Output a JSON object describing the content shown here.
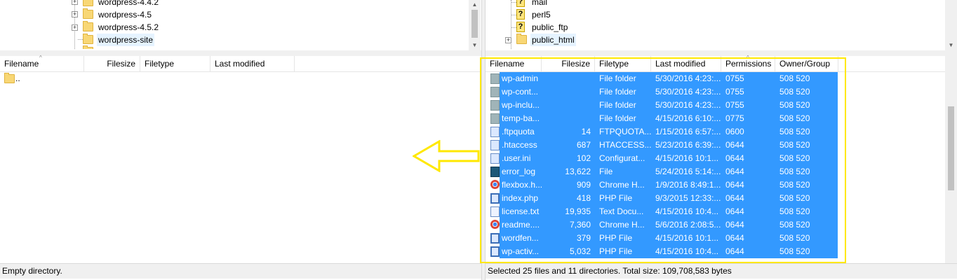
{
  "local_tree": {
    "items": [
      {
        "label": "wordpress-4.4.2",
        "expandable": true,
        "selected": false
      },
      {
        "label": "wordpress-4.5",
        "expandable": true,
        "selected": false
      },
      {
        "label": "wordpress-4.5.2",
        "expandable": true,
        "selected": false
      },
      {
        "label": "wordpress-site",
        "expandable": false,
        "selected": true
      }
    ]
  },
  "remote_tree": {
    "items": [
      {
        "label": "mail",
        "icon": "unknown-folder-icon",
        "selected": false
      },
      {
        "label": "perl5",
        "icon": "unknown-folder-icon",
        "selected": false
      },
      {
        "label": "public_ftp",
        "icon": "unknown-folder-icon",
        "selected": false
      },
      {
        "label": "public_html",
        "icon": "folder-icon",
        "selected": true
      }
    ]
  },
  "local_list": {
    "columns": [
      "Filename",
      "Filesize",
      "Filetype",
      "Last modified"
    ],
    "rows": [
      {
        "name": ".."
      }
    ]
  },
  "remote_list": {
    "columns": [
      "Filename",
      "Filesize",
      "Filetype",
      "Last modified",
      "Permissions",
      "Owner/Group"
    ],
    "rows": [
      {
        "name": "wp-admin",
        "size": "",
        "type": "File folder",
        "modified": "5/30/2016 4:23:...",
        "perm": "0755",
        "owner": "508 520",
        "icon": "folder"
      },
      {
        "name": "wp-cont...",
        "size": "",
        "type": "File folder",
        "modified": "5/30/2016 4:23:...",
        "perm": "0755",
        "owner": "508 520",
        "icon": "folder"
      },
      {
        "name": "wp-inclu...",
        "size": "",
        "type": "File folder",
        "modified": "5/30/2016 4:23:...",
        "perm": "0755",
        "owner": "508 520",
        "icon": "folder"
      },
      {
        "name": "temp-ba...",
        "size": "",
        "type": "File folder",
        "modified": "4/15/2016 6:10:...",
        "perm": "0775",
        "owner": "508 520",
        "icon": "folder"
      },
      {
        "name": ".ftpquota",
        "size": "14",
        "type": "FTPQUOTA...",
        "modified": "1/15/2016 6:57:...",
        "perm": "0600",
        "owner": "508 520",
        "icon": "file"
      },
      {
        "name": ".htaccess",
        "size": "687",
        "type": "HTACCESS...",
        "modified": "5/23/2016 6:39:...",
        "perm": "0644",
        "owner": "508 520",
        "icon": "file"
      },
      {
        "name": ".user.ini",
        "size": "102",
        "type": "Configurat...",
        "modified": "4/15/2016 10:1...",
        "perm": "0644",
        "owner": "508 520",
        "icon": "config"
      },
      {
        "name": "error_log",
        "size": "13,622",
        "type": "File",
        "modified": "5/24/2016 5:14:...",
        "perm": "0644",
        "owner": "508 520",
        "icon": "app"
      },
      {
        "name": "flexbox.h...",
        "size": "909",
        "type": "Chrome H...",
        "modified": "1/9/2016 8:49:1...",
        "perm": "0644",
        "owner": "508 520",
        "icon": "chrome"
      },
      {
        "name": "index.php",
        "size": "418",
        "type": "PHP File",
        "modified": "9/3/2015 12:33:...",
        "perm": "0644",
        "owner": "508 520",
        "icon": "php"
      },
      {
        "name": "license.txt",
        "size": "19,935",
        "type": "Text Docu...",
        "modified": "4/15/2016 10:4...",
        "perm": "0644",
        "owner": "508 520",
        "icon": "text"
      },
      {
        "name": "readme....",
        "size": "7,360",
        "type": "Chrome H...",
        "modified": "5/6/2016 2:08:5...",
        "perm": "0644",
        "owner": "508 520",
        "icon": "chrome"
      },
      {
        "name": "wordfen...",
        "size": "379",
        "type": "PHP File",
        "modified": "4/15/2016 10:1...",
        "perm": "0644",
        "owner": "508 520",
        "icon": "php"
      },
      {
        "name": "wp-activ...",
        "size": "5,032",
        "type": "PHP File",
        "modified": "4/15/2016 10:4...",
        "perm": "0644",
        "owner": "508 520",
        "icon": "php"
      }
    ]
  },
  "status": {
    "left": "Empty directory.",
    "right": "Selected 25 files and 11 directories. Total size: 109,708,583 bytes"
  },
  "colors": {
    "selection": "#3399ff",
    "highlight_box": "#ffe800",
    "arrow": "#ffe800"
  }
}
